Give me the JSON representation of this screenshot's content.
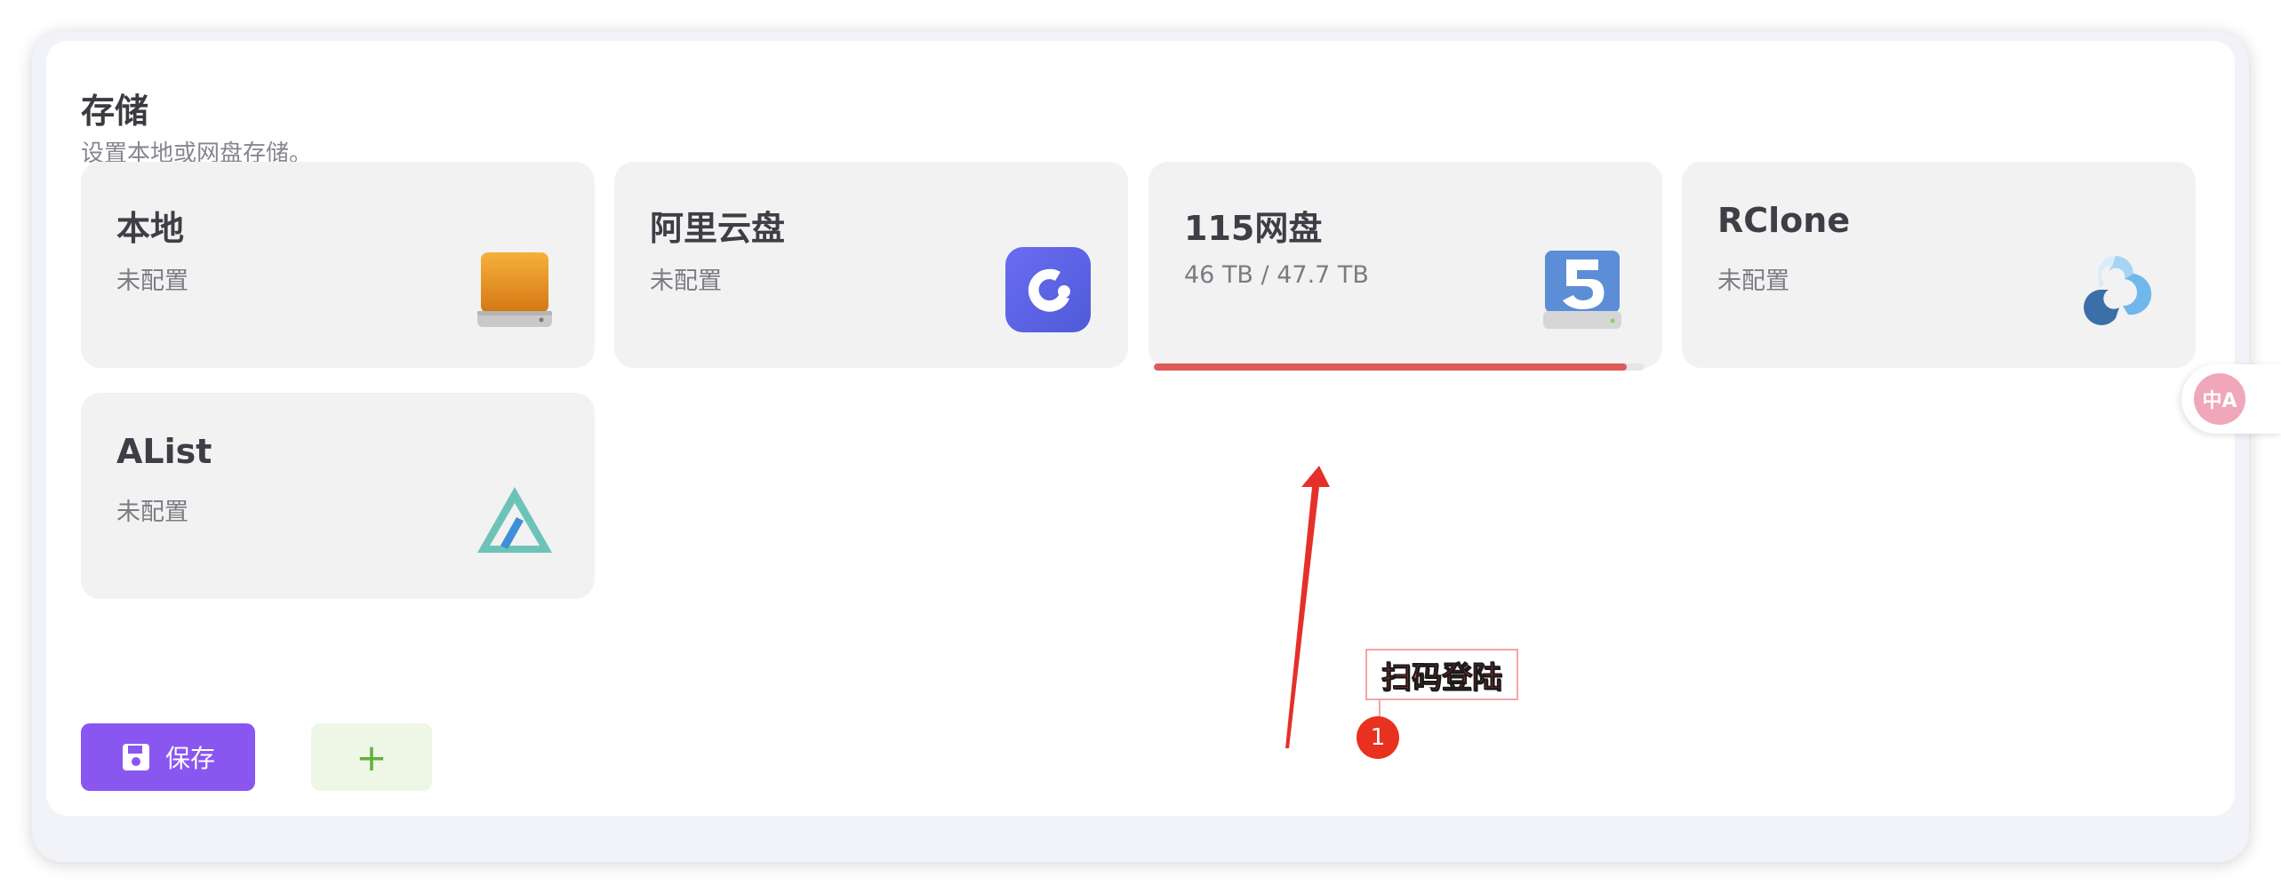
{
  "header": {
    "title": "存储",
    "subtitle": "设置本地或网盘存储。"
  },
  "cards": [
    {
      "name": "本地",
      "status": "未配置",
      "icon": "local-drive-icon"
    },
    {
      "name": "阿里云盘",
      "status": "未配置",
      "icon": "aliyundrive-icon"
    },
    {
      "name": "115网盘",
      "status": "46 TB / 47.7 TB",
      "icon": "115-drive-icon",
      "usage_fraction": 0.964
    },
    {
      "name": "RClone",
      "status": "未配置",
      "icon": "rclone-icon"
    },
    {
      "name": "AList",
      "status": "未配置",
      "icon": "alist-icon"
    }
  ],
  "actions": {
    "save_label": "保存",
    "add_label": "+"
  },
  "annotation": {
    "label": "扫码登陆",
    "number": "1"
  },
  "translate_badge": {
    "text": "中A"
  },
  "colors": {
    "accent": "#8a56f0",
    "usage_bar": "#e05a5a",
    "add_button_bg": "#eef7e6",
    "add_button_fg": "#5fb13e",
    "annotation_red": "#e8321f"
  }
}
